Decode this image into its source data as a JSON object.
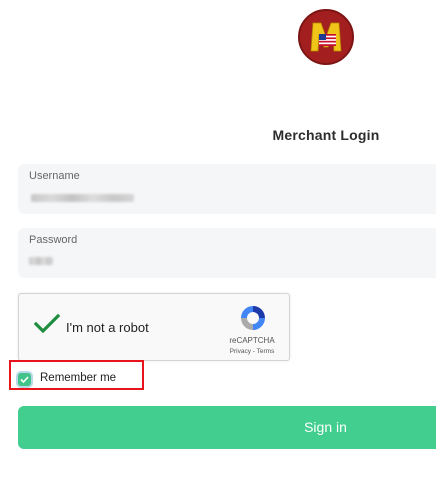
{
  "logo": {
    "letter": "M"
  },
  "page_title": "Merchant Login",
  "username": {
    "label": "Username",
    "value_masked": true
  },
  "password": {
    "label": "Password",
    "value_masked": true
  },
  "captcha": {
    "label": "I'm not a robot",
    "checked": true,
    "brand": "reCAPTCHA",
    "links": "Privacy - Terms"
  },
  "remember_me": {
    "label": "Remember me",
    "checked": true,
    "highlighted": true
  },
  "signin_button": {
    "label": "Sign in"
  },
  "colors": {
    "accent": "#41ce8e",
    "highlight_box": "#e8141c",
    "captcha_check": "#1e8e3e",
    "logo_background": "#a31f1f"
  }
}
